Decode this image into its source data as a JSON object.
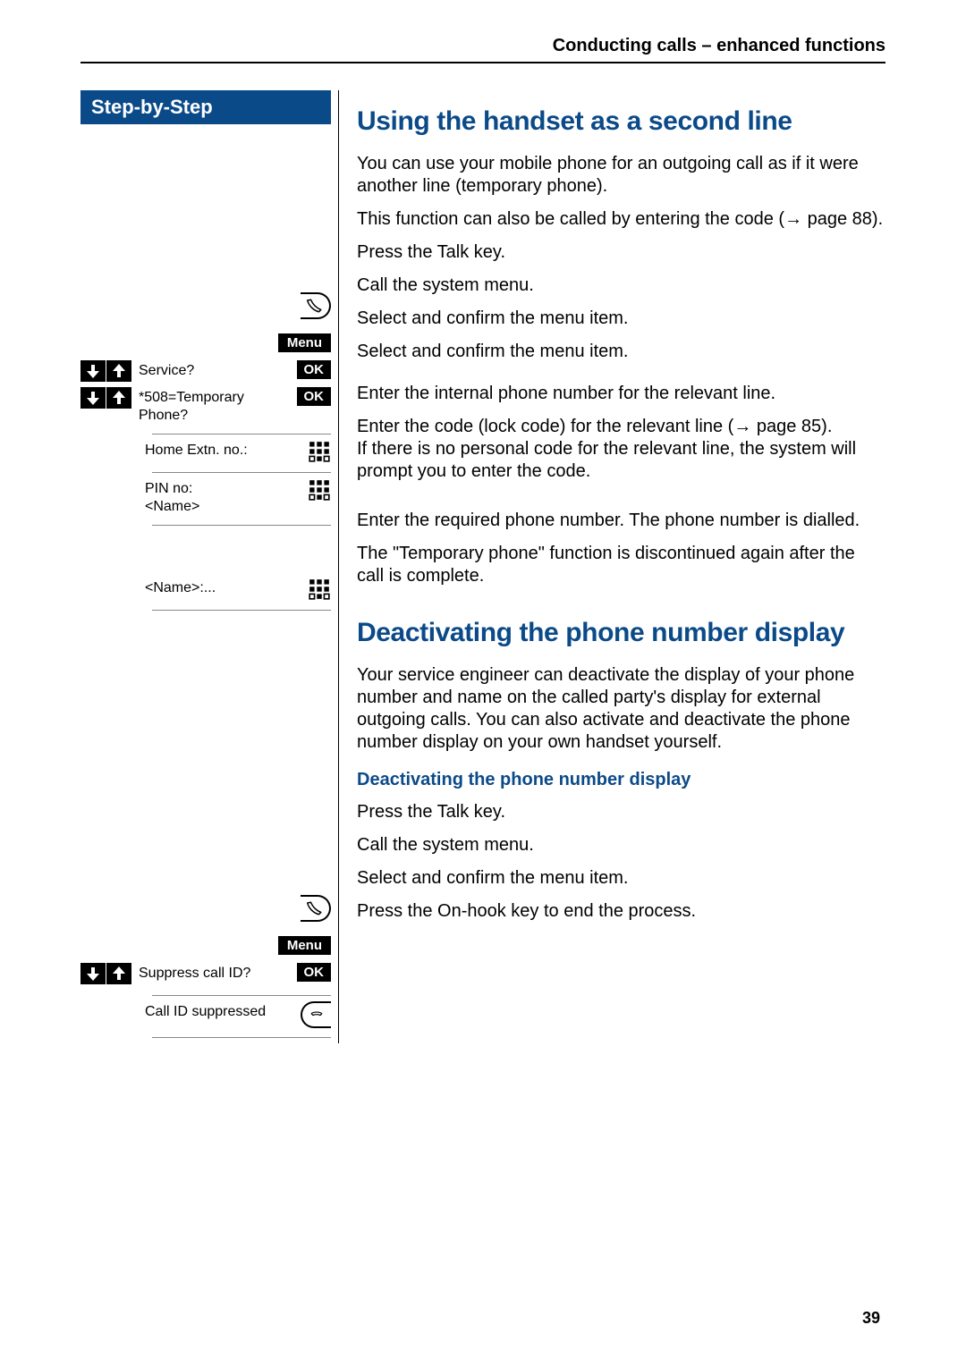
{
  "header": {
    "chapter_title": "Conducting calls – enhanced functions"
  },
  "sidebar": {
    "banner_label": "Step-by-Step"
  },
  "labels": {
    "menu": "Menu",
    "ok": "OK"
  },
  "displays": {
    "service": "Service?",
    "temp_phone": "*508=Temporary Phone?",
    "home_extn": "Home Extn. no.:",
    "pin_no_name": "PIN no:\n<Name>",
    "name_dots": "<Name>:...",
    "suppress_callid": "Suppress call ID?",
    "callid_suppressed": "Call ID suppressed"
  },
  "section1": {
    "title": "Using the handset as a second line",
    "intro_1": "You can use your mobile phone for an outgoing call as if it were another line (temporary phone).",
    "intro_2": "This function can also be called by entering the code (→ page 88).",
    "step_talk": "Press the Talk key.",
    "step_menu": "Call the system menu.",
    "step_select_1": "Select and confirm the menu item.",
    "step_select_2": "Select and confirm the menu item.",
    "step_home_extn": "Enter the internal phone number for the relevant line.",
    "step_pin": "Enter the code (lock code) for the relevant line (→ page 85).\nIf there is no personal code for the relevant line, the system will prompt you to enter the code.",
    "step_name": "Enter the required phone number. The phone number is dialled.",
    "outro": "The \"Temporary phone\" function is discontinued again after the call is complete."
  },
  "section2": {
    "title": "Deactivating the phone number display",
    "intro": "Your service engineer can deactivate the display of your phone number and name on the called party's display for external outgoing calls. You can also activate and deactivate the phone number display on your own handset yourself.",
    "sub_title": "Deactivating the phone number display",
    "step_talk": "Press the Talk key.",
    "step_menu": "Call the system menu.",
    "step_select": "Select and confirm the menu item.",
    "step_onhook": "Press the On-hook key to end the process."
  },
  "page_number": "39"
}
